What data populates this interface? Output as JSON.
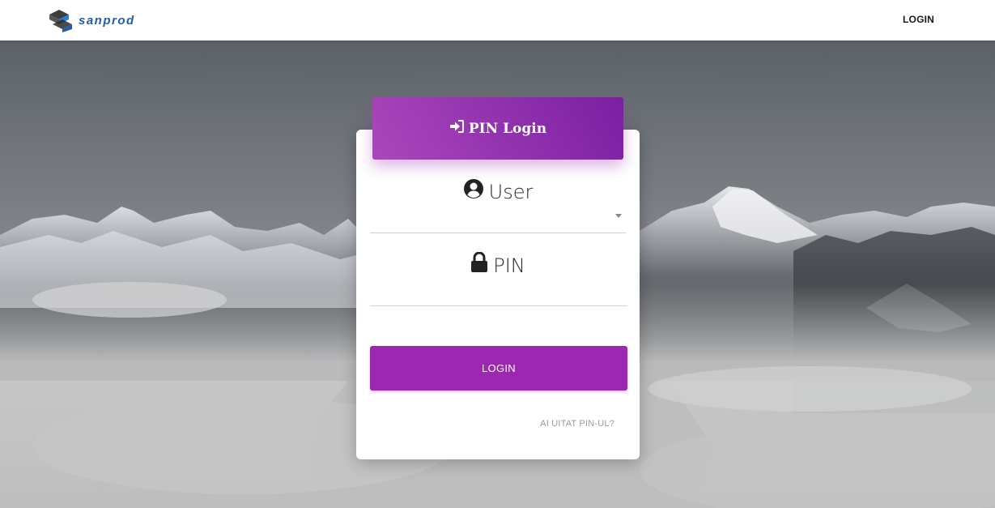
{
  "navbar": {
    "brand_name": "sanprod",
    "login_link": "LOGIN"
  },
  "card": {
    "header_title": "PIN Login",
    "user_label": "User",
    "user_select_value": "",
    "pin_label": "PIN",
    "pin_value": "",
    "login_button": "LOGIN",
    "forgot_link": "AI UITAT PIN-UL?"
  },
  "colors": {
    "accent": "#9c27b0",
    "header_gradient_start": "#ab47bc",
    "header_gradient_end": "#7b1fa2",
    "brand": "#1e5fa8"
  },
  "icons": {
    "brand_logo": "sanprod-logo-icon",
    "header": "sign-in-icon",
    "user": "user-circle-icon",
    "pin": "lock-icon",
    "select": "caret-down-icon"
  }
}
